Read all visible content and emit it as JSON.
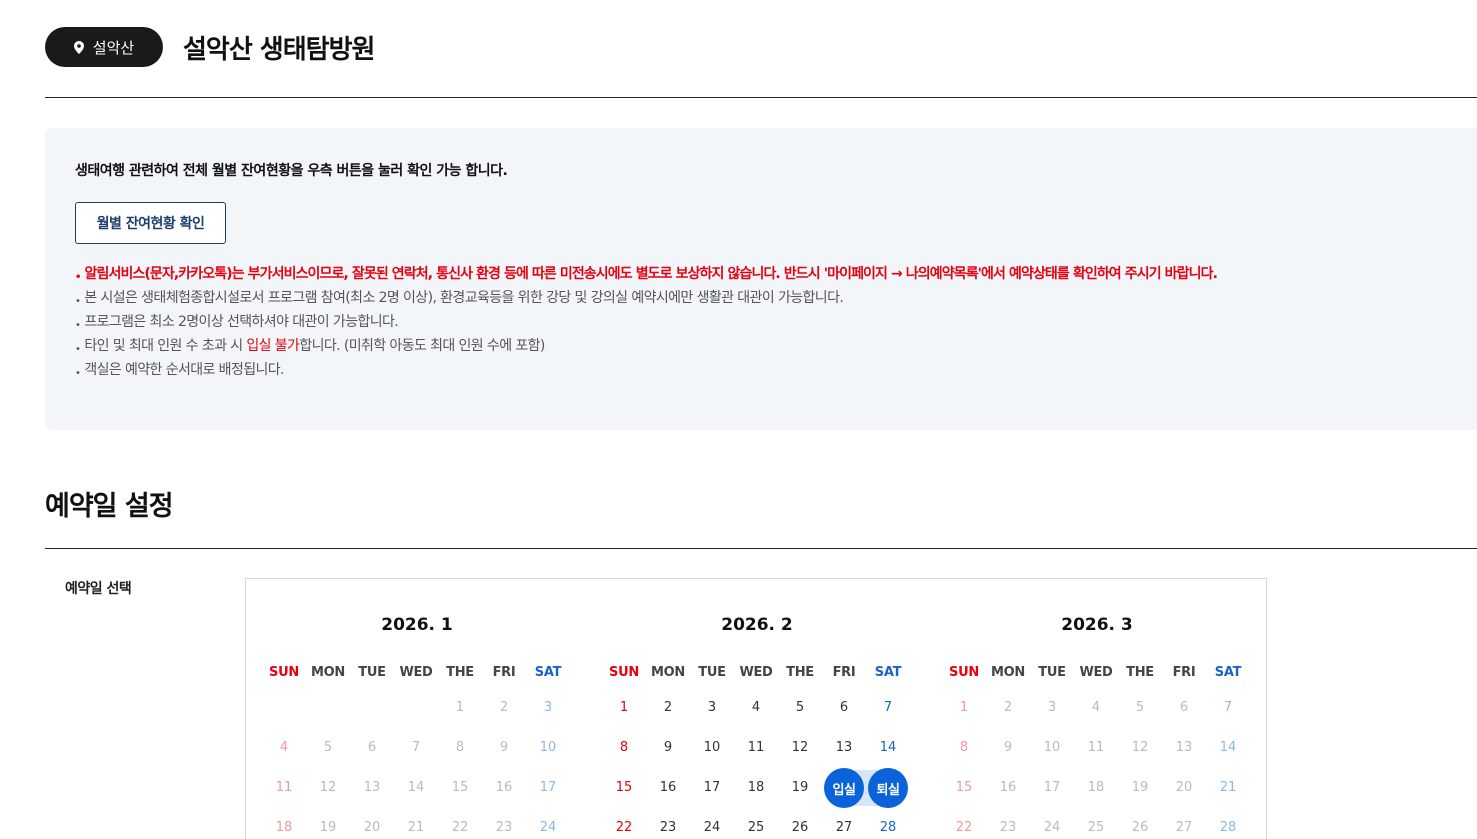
{
  "header": {
    "location_badge": "설악산",
    "title": "설악산 생태탐방원"
  },
  "notice": {
    "lead": "생태여행 관련하여 전체 월별 잔여현황을 우측 버튼을 눌러 확인 가능 합니다.",
    "monthly_button": "월별 잔여현황 확인",
    "alert": "알림서비스(문자,카카오톡)는 부가서비스이므로, 잘못된 연락처, 통신사 환경 등에 따른 미전송시에도 별도로 보상하지 않습니다. 반드시 '마이페이지 → 나의예약목록'에서 예약상태를 확인하여 주시기 바랍니다.",
    "note1": "본 시설은 생태체험종합시설로서 프로그램 참여(최소 2명 이상), 환경교육등을 위한 강당 및 강의실 예약시에만 생활관 대관이 가능합니다.",
    "note2": "프로그램은 최소 2명이상 선택하셔야 대관이 가능합니다.",
    "note3_pre": "타인 및 최대 인원 수 초과 시 ",
    "note3_red": "입실 불가",
    "note3_post": "합니다. (미취학 아동도 최대 인원 수에 포함)",
    "note4": "객실은 예약한 순서대로 배정됩니다."
  },
  "section": {
    "title": "예약일 설정",
    "field_label": "예약일 선택"
  },
  "calendar": {
    "weekdays": [
      "SUN",
      "MON",
      "TUE",
      "WED",
      "THE",
      "FRI",
      "SAT"
    ],
    "checkin_label": "입실",
    "checkout_label": "퇴실",
    "months": [
      {
        "title": "2026. 1",
        "weeks": [
          [
            "",
            "",
            "",
            "",
            "1",
            "2",
            "3"
          ],
          [
            "4",
            "5",
            "6",
            "7",
            "8",
            "9",
            "10"
          ],
          [
            "11",
            "12",
            "13",
            "14",
            "15",
            "16",
            "17"
          ],
          [
            "18",
            "19",
            "20",
            "21",
            "22",
            "23",
            "24"
          ]
        ],
        "available_from": 99,
        "checkin": null,
        "checkout": null
      },
      {
        "title": "2026. 2",
        "weeks": [
          [
            "1",
            "2",
            "3",
            "4",
            "5",
            "6",
            "7"
          ],
          [
            "8",
            "9",
            "10",
            "11",
            "12",
            "13",
            "14"
          ],
          [
            "15",
            "16",
            "17",
            "18",
            "19",
            "20",
            "21"
          ],
          [
            "22",
            "23",
            "24",
            "25",
            "26",
            "27",
            "28"
          ]
        ],
        "available_from": 1,
        "checkin": "20",
        "checkout": "21"
      },
      {
        "title": "2026. 3",
        "weeks": [
          [
            "1",
            "2",
            "3",
            "4",
            "5",
            "6",
            "7"
          ],
          [
            "8",
            "9",
            "10",
            "11",
            "12",
            "13",
            "14"
          ],
          [
            "15",
            "16",
            "17",
            "18",
            "19",
            "20",
            "21"
          ],
          [
            "22",
            "23",
            "24",
            "25",
            "26",
            "27",
            "28"
          ]
        ],
        "available_from": 99,
        "checkin": null,
        "checkout": null
      }
    ]
  }
}
